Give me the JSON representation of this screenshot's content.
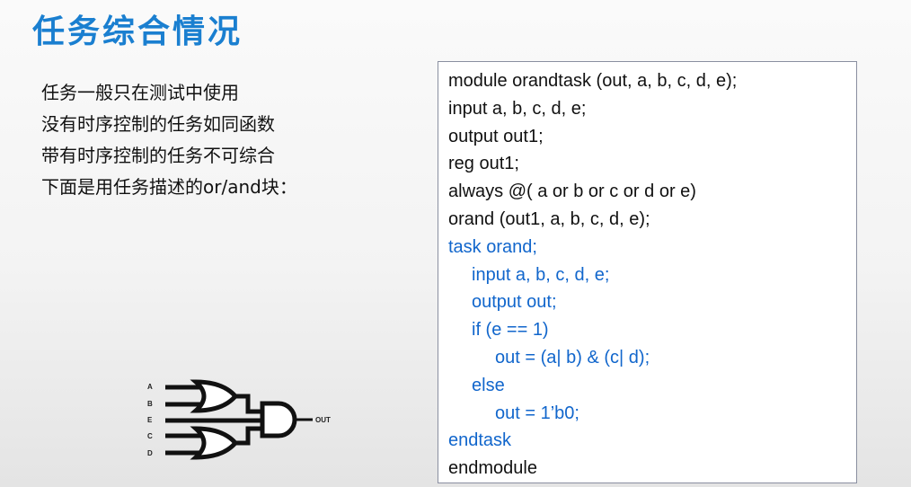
{
  "title": "任务综合情况",
  "bullets": [
    "任务一般只在测试中使用",
    "没有时序控制的任务如同函数",
    "带有时序控制的任务不可综合",
    "下面是用任务描述的or/and块："
  ],
  "code": [
    {
      "text": "module orandtask (out, a, b, c, d, e);",
      "indent": 0,
      "color": "black"
    },
    {
      "text": "input a, b, c, d, e;",
      "indent": 0,
      "color": "black"
    },
    {
      "text": "output out1;",
      "indent": 0,
      "color": "black"
    },
    {
      "text": "reg out1;",
      "indent": 0,
      "color": "black"
    },
    {
      "text": "always @( a or b or c or d or e)",
      "indent": 0,
      "color": "black"
    },
    {
      "text": "orand (out1, a, b, c, d, e);",
      "indent": 0,
      "color": "black"
    },
    {
      "text": "task orand;",
      "indent": 0,
      "color": "blue"
    },
    {
      "text": "input a, b, c, d, e;",
      "indent": 1,
      "color": "blue"
    },
    {
      "text": "output out;",
      "indent": 1,
      "color": "blue"
    },
    {
      "text": "if (e == 1)",
      "indent": 1,
      "color": "blue"
    },
    {
      "text": "out = (a| b) & (c| d);",
      "indent": 2,
      "color": "blue"
    },
    {
      "text": "else",
      "indent": 1,
      "color": "blue"
    },
    {
      "text": "out = 1’b0;",
      "indent": 2,
      "color": "blue"
    },
    {
      "text": "endtask",
      "indent": 0,
      "color": "blue"
    },
    {
      "text": "endmodule",
      "indent": 0,
      "color": "black"
    }
  ],
  "diagram": {
    "input_labels": [
      "A",
      "B",
      "E",
      "C",
      "D"
    ],
    "output_label": "OUT"
  },
  "colors": {
    "title": "#1a7fd0",
    "code_blue": "#1166cc",
    "code_black": "#111111"
  }
}
